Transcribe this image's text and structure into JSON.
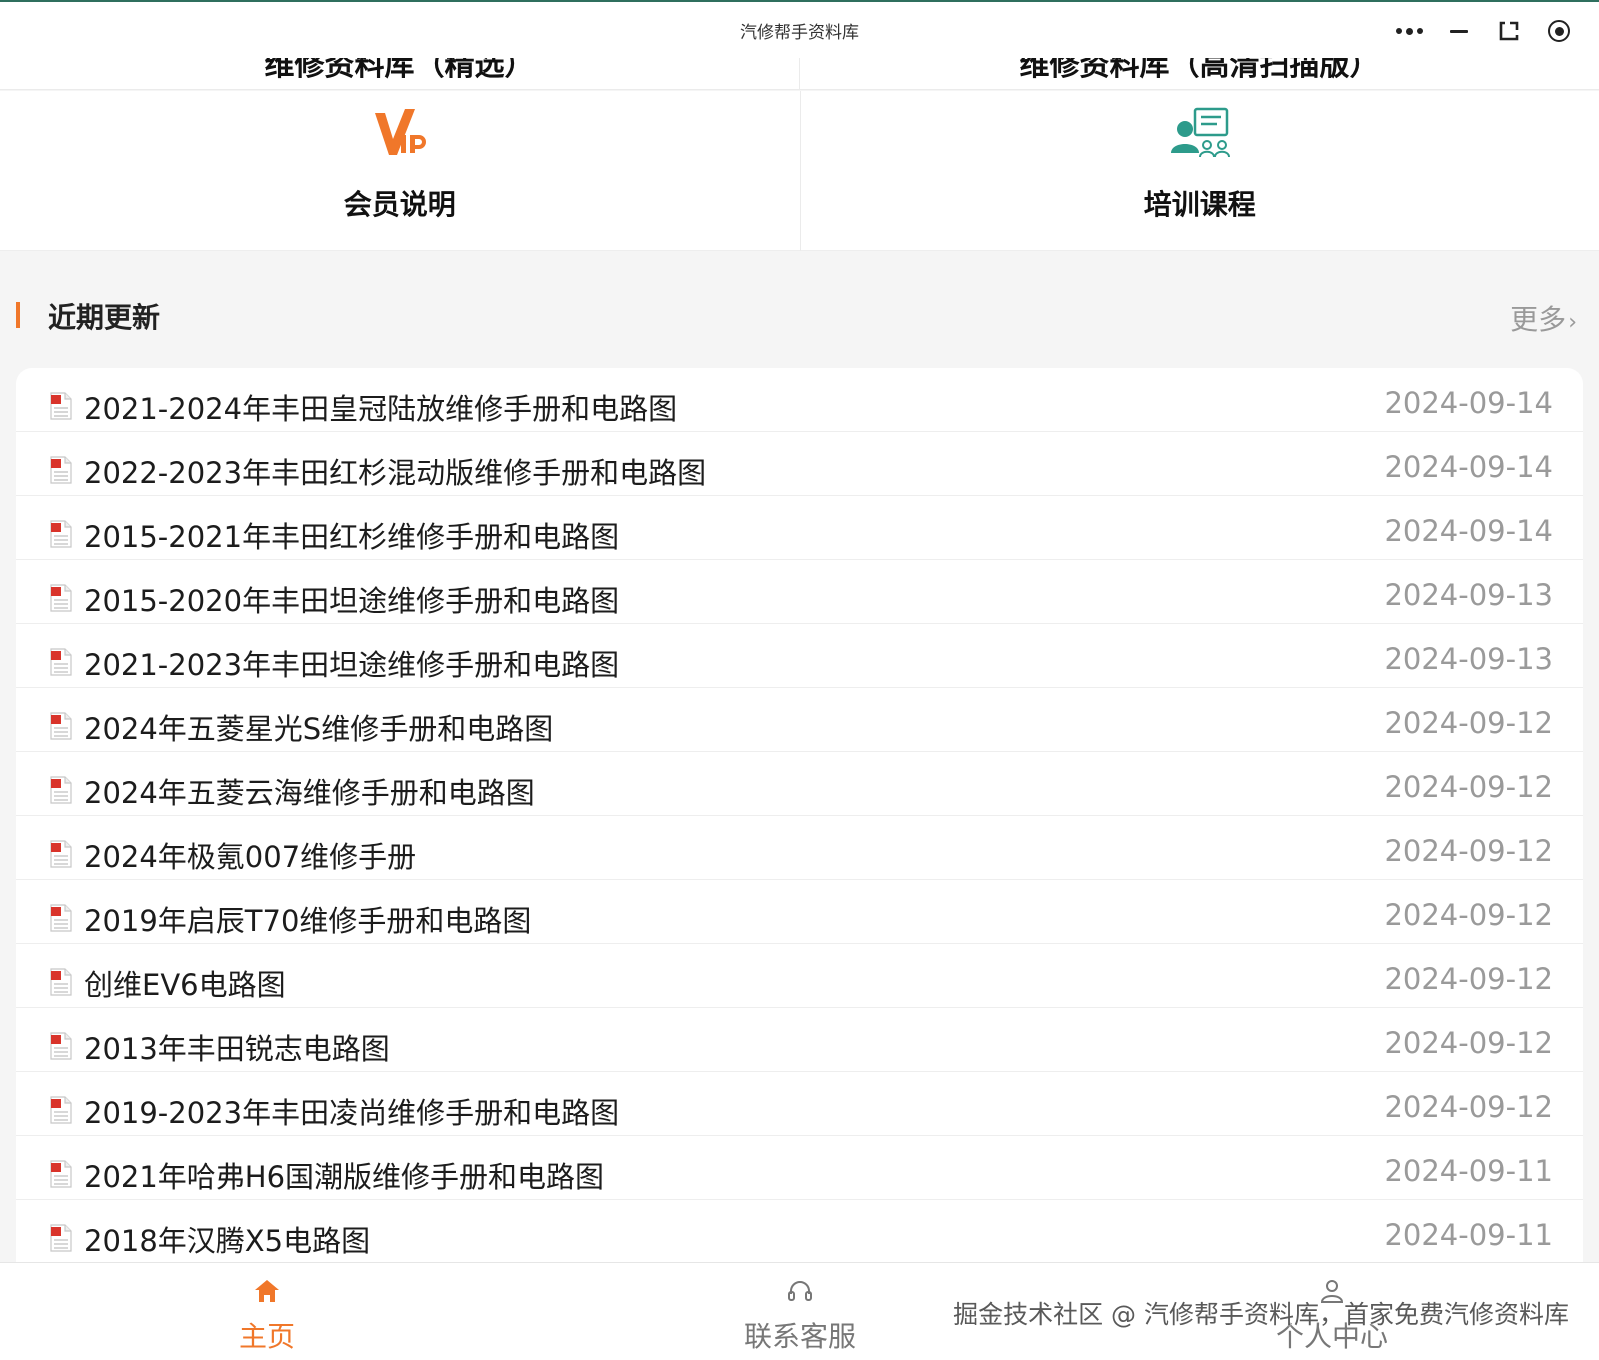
{
  "window": {
    "title": "汽修帮手资料库"
  },
  "capsule": {
    "icons": [
      "more-dots-icon",
      "minimize-icon",
      "restore-icon",
      "target-icon"
    ]
  },
  "cutoff": {
    "left_label": "维修资料库（精选）",
    "right_label": "维修资料库（高清扫描版）"
  },
  "grid": {
    "items": [
      {
        "label": "会员说明",
        "icon": "vip-icon"
      },
      {
        "label": "培训课程",
        "icon": "training-icon"
      }
    ]
  },
  "section": {
    "title": "近期更新",
    "more_label": "更多",
    "more_chevron": "›"
  },
  "list": {
    "items": [
      {
        "name": "2021-2024年丰田皇冠陆放维修手册和电路图",
        "date": "2024-09-14"
      },
      {
        "name": "2022-2023年丰田红杉混动版维修手册和电路图",
        "date": "2024-09-14"
      },
      {
        "name": "2015-2021年丰田红杉维修手册和电路图",
        "date": "2024-09-14"
      },
      {
        "name": "2015-2020年丰田坦途维修手册和电路图",
        "date": "2024-09-13"
      },
      {
        "name": "2021-2023年丰田坦途维修手册和电路图",
        "date": "2024-09-13"
      },
      {
        "name": "2024年五菱星光S维修手册和电路图",
        "date": "2024-09-12"
      },
      {
        "name": "2024年五菱云海维修手册和电路图",
        "date": "2024-09-12"
      },
      {
        "name": "2024年极氪007维修手册",
        "date": "2024-09-12"
      },
      {
        "name": "2019年启辰T70维修手册和电路图",
        "date": "2024-09-12"
      },
      {
        "name": "创维EV6电路图",
        "date": "2024-09-12"
      },
      {
        "name": "2013年丰田锐志电路图",
        "date": "2024-09-12"
      },
      {
        "name": "2019-2023年丰田凌尚维修手册和电路图",
        "date": "2024-09-12"
      },
      {
        "name": "2021年哈弗H6国潮版维修手册和电路图",
        "date": "2024-09-11"
      },
      {
        "name": "2018年汉腾X5电路图",
        "date": "2024-09-11"
      }
    ]
  },
  "tabbar": {
    "tabs": [
      {
        "label": "主页",
        "icon": "home-icon",
        "active": true
      },
      {
        "label": "联系客服",
        "icon": "headset-icon",
        "active": false
      },
      {
        "label": "个人中心",
        "icon": "user-icon",
        "active": false
      }
    ],
    "watermark": "掘金技术社区 @ 汽修帮手资料库，首家免费汽修资料库"
  },
  "colors": {
    "accent": "#f0772a",
    "vip": "#f0772a",
    "training_icon": "#2d9b8b",
    "pdf_red": "#d9342b",
    "date_gray": "#9a9a9a",
    "titlebar_border": "#2f6f5e"
  }
}
